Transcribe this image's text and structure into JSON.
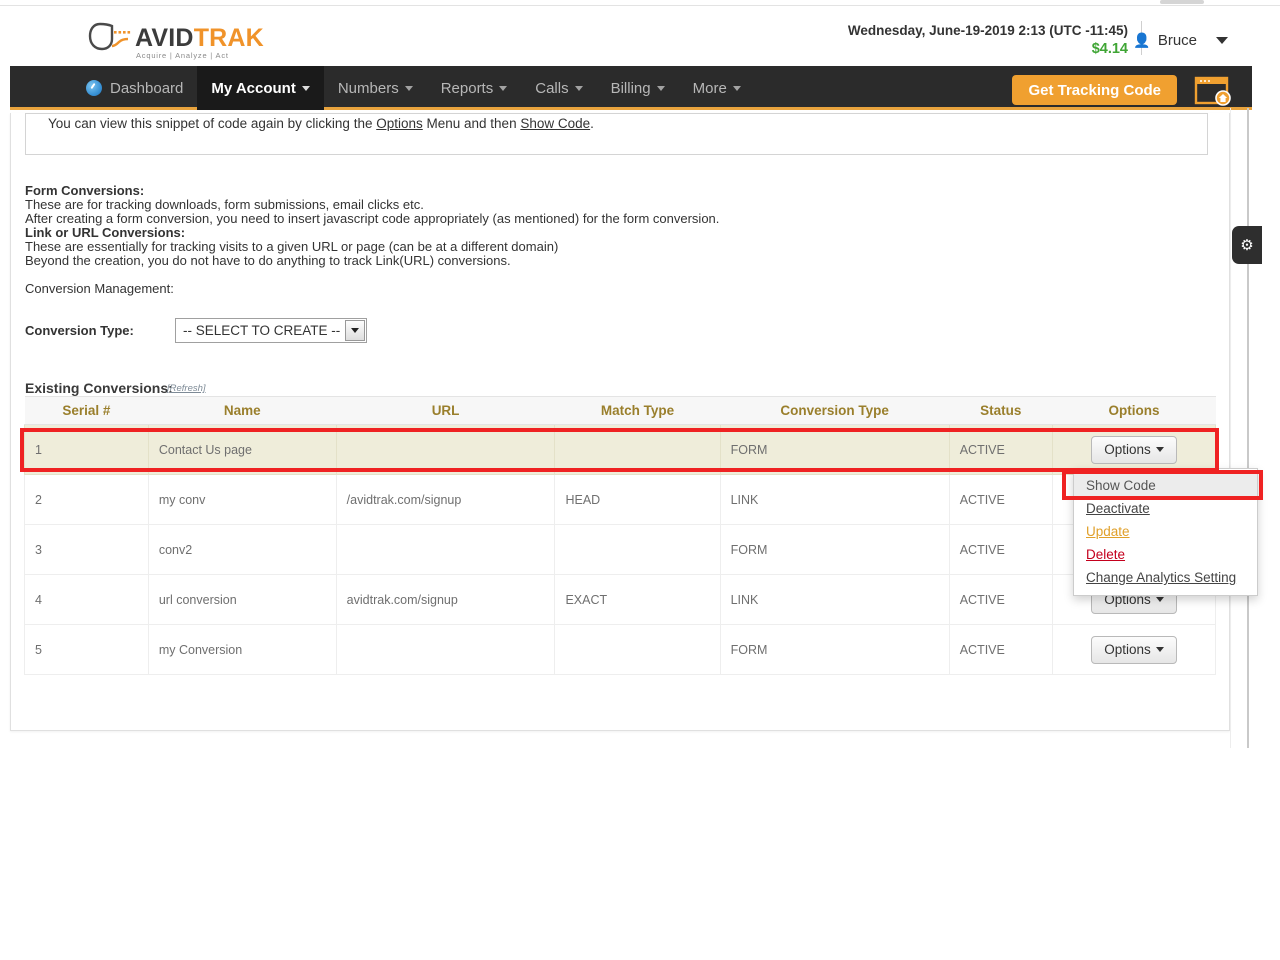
{
  "brand": {
    "name_part1": "AVID",
    "name_part2": "TRAK",
    "tagline": "Acquire  |  Analyze  |  Act",
    "logo_icon": "avidtrak-a-mark-icon",
    "accent_color": "#f0a030",
    "nav_bg_color": "#2b2b2b"
  },
  "header": {
    "datetime": "Wednesday, June-19-2019 2:13 (UTC -11:45)",
    "balance": "$4.14",
    "balance_color": "#3fa535",
    "user_name": "Bruce",
    "user_icon": "person-icon",
    "user_caret_icon": "caret-down-icon"
  },
  "nav": {
    "items": [
      {
        "label": "Dashboard",
        "icon": "dashboard-gauge-icon",
        "has_caret": false,
        "active": false
      },
      {
        "label": "My Account",
        "icon": "",
        "has_caret": true,
        "active": true
      },
      {
        "label": "Numbers",
        "icon": "",
        "has_caret": true,
        "active": false
      },
      {
        "label": "Reports",
        "icon": "",
        "has_caret": true,
        "active": false
      },
      {
        "label": "Calls",
        "icon": "",
        "has_caret": true,
        "active": false
      },
      {
        "label": "Billing",
        "icon": "",
        "has_caret": true,
        "active": false
      },
      {
        "label": "More",
        "icon": "",
        "has_caret": true,
        "active": false
      }
    ],
    "tracking_button": "Get Tracking Code",
    "window_icon": "popup-window-home-icon"
  },
  "snippet": {
    "line_pre": "You can view this snippet of code again by clicking the ",
    "link1": "Options",
    "line_mid": " Menu and then ",
    "link2": "Show Code",
    "line_end": "."
  },
  "info": {
    "form_heading": "Form Conversions:",
    "form_line1": "These are for tracking downloads, form submissions, email clicks etc.",
    "form_line2": "After creating a form conversion, you need to insert javascript code appropriately (as mentioned) for the form conversion.",
    "link_heading": "Link or URL Conversions:",
    "link_line1": "These are essentially for tracking visits to a given URL or page (can be at a different domain)",
    "link_line2": "Beyond the creation, you do not have to do anything to track Link(URL) conversions.",
    "management_heading": "Conversion Management:"
  },
  "conversion_type": {
    "label": "Conversion Type:",
    "selected": "-- SELECT TO CREATE --",
    "dropdown_icon": "caret-down-icon"
  },
  "existing": {
    "label": "Existing Conversions:",
    "refresh_label": "[Refresh]"
  },
  "table": {
    "columns": [
      "Serial #",
      "Name",
      "URL",
      "Match Type",
      "Conversion Type",
      "Status",
      "Options"
    ],
    "options_button_label": "Options",
    "rows": [
      {
        "serial": "1",
        "name": "Contact Us page",
        "url": "",
        "match": "",
        "ctype": "FORM",
        "status": "ACTIVE",
        "highlighted": true
      },
      {
        "serial": "2",
        "name": "my conv",
        "url": "/avidtrak.com/signup",
        "match": "HEAD",
        "ctype": "LINK",
        "status": "ACTIVE",
        "highlighted": false
      },
      {
        "serial": "3",
        "name": "conv2",
        "url": "",
        "match": "",
        "ctype": "FORM",
        "status": "ACTIVE",
        "highlighted": false
      },
      {
        "serial": "4",
        "name": "url conversion",
        "url": "avidtrak.com/signup",
        "match": "EXACT",
        "ctype": "LINK",
        "status": "ACTIVE",
        "highlighted": false
      },
      {
        "serial": "5",
        "name": "my Conversion",
        "url": "",
        "match": "",
        "ctype": "FORM",
        "status": "ACTIVE",
        "highlighted": false
      }
    ]
  },
  "options_menu": {
    "items": [
      {
        "label": "Show Code",
        "style": "hover"
      },
      {
        "label": "Deactivate",
        "style": "underline"
      },
      {
        "label": "Update",
        "style": "orange"
      },
      {
        "label": "Delete",
        "style": "red"
      },
      {
        "label": "Change Analytics Setting",
        "style": "underline"
      }
    ]
  },
  "annotations": {
    "color": "#ef2222",
    "boxes": [
      "highlighted-table-row-1",
      "show-code-menu-item"
    ]
  },
  "side_tab": {
    "icon": "gear-icon"
  }
}
